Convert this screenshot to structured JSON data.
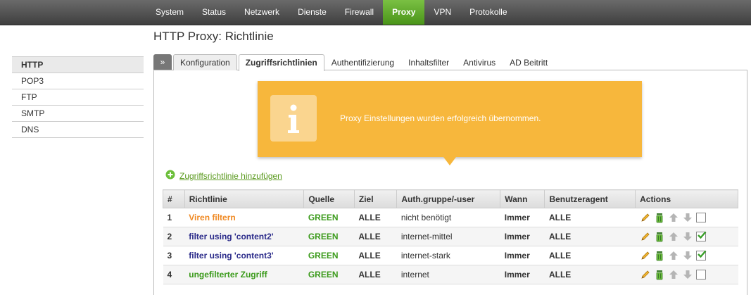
{
  "topnav": [
    "System",
    "Status",
    "Netzwerk",
    "Dienste",
    "Firewall",
    "Proxy",
    "VPN",
    "Protokolle"
  ],
  "topnav_active": "Proxy",
  "page_title": "HTTP Proxy: Richtlinie",
  "sidebar": [
    "HTTP",
    "POP3",
    "FTP",
    "SMTP",
    "DNS"
  ],
  "sidebar_active": "HTTP",
  "tabs": {
    "expander": "»",
    "items": [
      "Konfiguration",
      "Zugriffsrichtlinien",
      "Authentifizierung",
      "Inhaltsfilter",
      "Antivirus",
      "AD Beitritt"
    ],
    "active": "Zugriffsrichtlinien"
  },
  "notice": {
    "message": "Proxy Einstellungen wurden erfolgreich übernommen.",
    "icon": "info-icon"
  },
  "add_link": "Zugriffsrichtlinie hinzufügen",
  "table": {
    "headers": [
      "#",
      "Richtlinie",
      "Quelle",
      "Ziel",
      "Auth.gruppe/-user",
      "Wann",
      "Benutzeragent",
      "Actions"
    ],
    "rows": [
      {
        "num": "1",
        "name": "Viren filtern",
        "color": "#f08a24",
        "quelle": "GREEN",
        "ziel": "ALLE",
        "auth": "nicht benötigt",
        "wann": "Immer",
        "agent": "ALLE",
        "enabled": false
      },
      {
        "num": "2",
        "name": "filter using 'content2'",
        "color": "#2b2b8a",
        "quelle": "GREEN",
        "ziel": "ALLE",
        "auth": "internet-mittel",
        "wann": "Immer",
        "agent": "ALLE",
        "enabled": true
      },
      {
        "num": "3",
        "name": "filter using 'content3'",
        "color": "#2b2b8a",
        "quelle": "GREEN",
        "ziel": "ALLE",
        "auth": "internet-stark",
        "wann": "Immer",
        "agent": "ALLE",
        "enabled": true
      },
      {
        "num": "4",
        "name": "ungefilterter Zugriff",
        "color": "#3a9a1a",
        "quelle": "GREEN",
        "ziel": "ALLE",
        "auth": "internet",
        "wann": "Immer",
        "agent": "ALLE",
        "enabled": false
      }
    ]
  },
  "colors": {
    "accent": "#5aa82a",
    "notice": "#f7b73c",
    "green_text": "#3a9a1a"
  }
}
